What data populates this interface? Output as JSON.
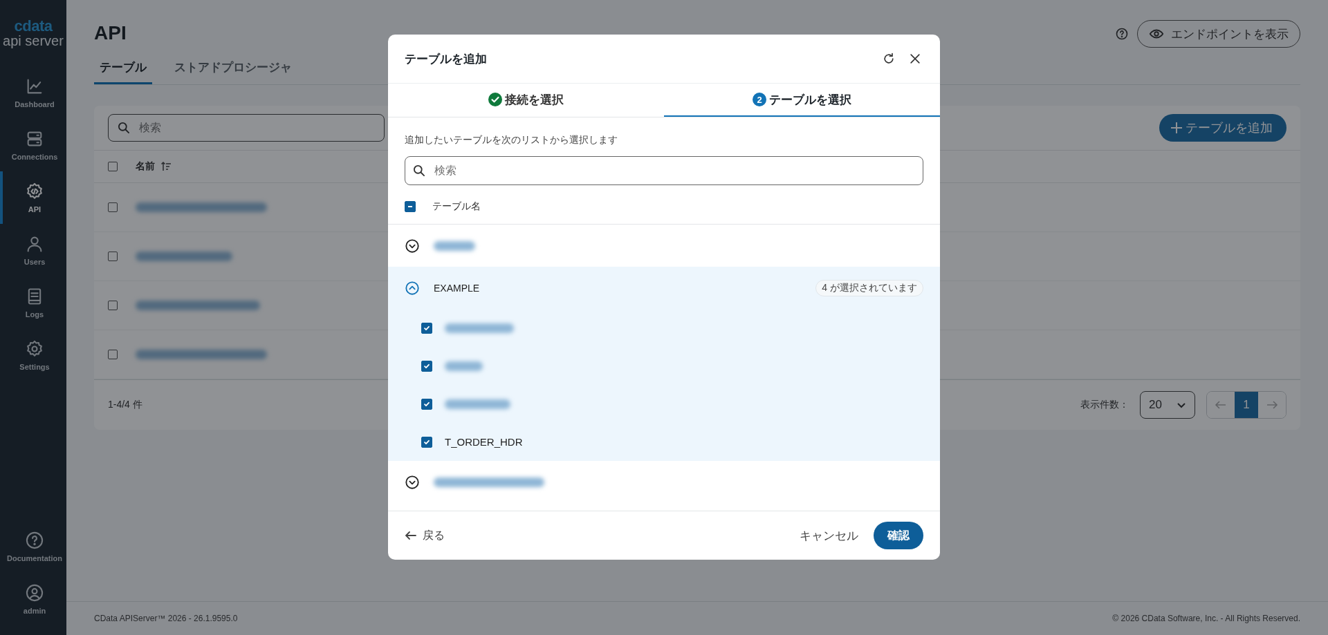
{
  "sidebar": {
    "logo": {
      "brand": "cdata",
      "product": "api server"
    },
    "items": [
      {
        "label": "Dashboard",
        "kind": "chart",
        "selected": false
      },
      {
        "label": "Connections",
        "kind": "server",
        "selected": false
      },
      {
        "label": "API",
        "kind": "api",
        "selected": true
      },
      {
        "label": "Users",
        "kind": "user",
        "selected": false
      },
      {
        "label": "Logs",
        "kind": "book",
        "selected": false
      },
      {
        "label": "Settings",
        "kind": "gear",
        "selected": false
      }
    ],
    "bottom_items": [
      {
        "label": "Documentation",
        "kind": "help"
      },
      {
        "label": "admin",
        "kind": "account"
      }
    ]
  },
  "page": {
    "title": "API",
    "endpoint_button": "エンドポイントを表示",
    "tabs": [
      {
        "label": "テーブル",
        "selected": true
      },
      {
        "label": "ストアドプロシージャ",
        "selected": false
      }
    ],
    "search": {
      "placeholder": "検索"
    },
    "add_button": "テーブルを追加",
    "table": {
      "select_all": {
        "checked": false
      },
      "column": "名前",
      "rows": [
        {
          "checked": false
        },
        {
          "checked": false
        },
        {
          "checked": false
        },
        {
          "checked": false
        }
      ]
    },
    "summary": "1-4/4 件",
    "page_size_label": "表示件数：",
    "page_size": "20",
    "pages": [
      {
        "label": "1",
        "selected": true
      }
    ]
  },
  "footer": {
    "version": "CData APIServer™ 2026 - 26.1.9595.0",
    "copyright": "© 2026 CData Software, Inc. - All Rights Reserved."
  },
  "dialog": {
    "title": "テーブルを追加",
    "steps": [
      {
        "label": "接続を選択",
        "kind": "done",
        "selected": false
      },
      {
        "label": "テーブルを選択",
        "number": "2",
        "kind": "numbered",
        "selected": true
      }
    ],
    "instruction": "追加したいテーブルを次のリストから選択します",
    "search": {
      "placeholder": "検索"
    },
    "select_all": {
      "indeterminate": true
    },
    "column": "テーブル名",
    "groups": [
      {
        "expanded": false
      },
      {
        "name": "EXAMPLE",
        "expanded": true,
        "badge": "4 が選択されています",
        "children": [
          {
            "checked": true
          },
          {
            "checked": true
          },
          {
            "checked": true
          },
          {
            "name": "T_ORDER_HDR",
            "checked": true
          }
        ]
      },
      {
        "expanded": false
      }
    ],
    "back_button": "戻る",
    "cancel_button": "キャンセル",
    "confirm_button": "確認"
  }
}
